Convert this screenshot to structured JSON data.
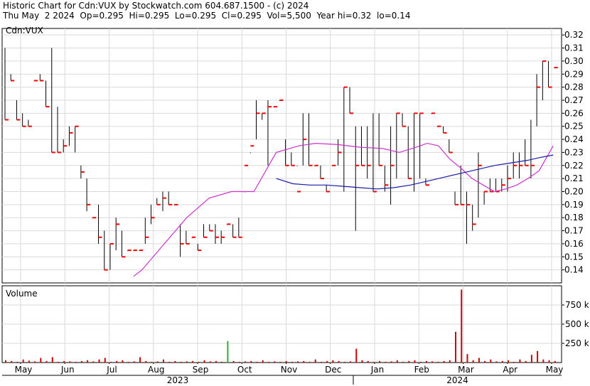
{
  "header": {
    "line1": "Historic Chart for Cdn:VUX by Stockwatch.com 604.687.1500 - (c) 2024",
    "line2": "Thu May  2 2024  Op=0.295  Hi=0.295  Lo=0.295  Cl=0.295  Vol=5,500  Year hi=0.32  lo=0.14"
  },
  "chart_data": {
    "type": "ohlc",
    "symbol_label": "Cdn:VUX",
    "volume_label": "Volume",
    "price_axis": {
      "min": 0.13,
      "max": 0.325,
      "ticks": [
        "0.32",
        "0.31",
        "0.30",
        "0.29",
        "0.28",
        "0.27",
        "0.26",
        "0.25",
        "0.24",
        "0.23",
        "0.22",
        "0.21",
        "0.20",
        "0.19",
        "0.18",
        "0.17",
        "0.16",
        "0.15",
        "0.14"
      ]
    },
    "volume_axis": {
      "min": 0,
      "max": 1000000,
      "ticks": [
        "750 k",
        "500 k",
        "250 k"
      ]
    },
    "months": [
      "May",
      "Jun",
      "Jul",
      "Aug",
      "Sep",
      "Oct",
      "Nov",
      "Dec",
      "Jan",
      "Feb",
      "Mar",
      "Apr",
      "May"
    ],
    "years": [
      "2023",
      "2024"
    ],
    "colors": {
      "bar": "#000000",
      "close_tick": "#ff0000",
      "ma_short": "#cc33cc",
      "ma_long": "#1a1aa8",
      "volume": "#cc0000",
      "volume_up": "#33aa33",
      "grid": "#d9d9d9"
    },
    "bars": [
      [
        0.31,
        0.255,
        0.255
      ],
      [
        0.29,
        0.285,
        0.285
      ],
      [
        0.27,
        0.255,
        0.255
      ],
      [
        0.26,
        0.25,
        0.25
      ],
      [
        0.255,
        0.25,
        0.25
      ],
      [
        0.285,
        0.285,
        0.285
      ],
      [
        0.29,
        0.285,
        0.285
      ],
      [
        0.285,
        0.265,
        0.265
      ],
      [
        0.31,
        0.23,
        0.23
      ],
      [
        0.265,
        0.23,
        0.23
      ],
      [
        0.24,
        0.23,
        0.235
      ],
      [
        0.25,
        0.235,
        0.245
      ],
      [
        0.25,
        0.23,
        0.25
      ],
      [
        0.22,
        0.21,
        0.215
      ],
      [
        0.21,
        0.185,
        0.19
      ],
      [
        0.18,
        0.18,
        0.18
      ],
      [
        0.19,
        0.16,
        0.165
      ],
      [
        0.17,
        0.14,
        0.14
      ],
      [
        0.16,
        0.14,
        0.16
      ],
      [
        0.18,
        0.155,
        0.175
      ],
      [
        0.17,
        0.15,
        0.15
      ],
      [
        0.155,
        0.155,
        0.155
      ],
      [
        0.155,
        0.155,
        0.155
      ],
      [
        0.155,
        0.155,
        0.155
      ],
      [
        0.18,
        0.16,
        0.165
      ],
      [
        0.19,
        0.175,
        0.18
      ],
      [
        0.195,
        0.19,
        0.19
      ],
      [
        0.2,
        0.185,
        0.195
      ],
      [
        0.2,
        0.19,
        0.19
      ],
      [
        0.19,
        0.19,
        0.19
      ],
      [
        0.175,
        0.15,
        0.16
      ],
      [
        0.17,
        0.16,
        0.16
      ],
      [
        0.165,
        0.165,
        0.165
      ],
      [
        0.16,
        0.155,
        0.155
      ],
      [
        0.175,
        0.165,
        0.165
      ],
      [
        0.175,
        0.17,
        0.17
      ],
      [
        0.175,
        0.16,
        0.165
      ],
      [
        0.17,
        0.16,
        0.165
      ],
      [
        0.175,
        0.175,
        0.175
      ],
      [
        0.175,
        0.165,
        0.165
      ],
      [
        0.18,
        0.165,
        0.165
      ],
      [
        0.2,
        0.22,
        0.22
      ],
      [
        0.23,
        0.235,
        0.235
      ],
      [
        0.27,
        0.24,
        0.26
      ],
      [
        0.26,
        0.255,
        0.26
      ],
      [
        0.27,
        0.22,
        0.265
      ],
      [
        0.265,
        0.265,
        0.265
      ],
      [
        0.27,
        0.27,
        0.27
      ],
      [
        0.24,
        0.22,
        0.22
      ],
      [
        0.23,
        0.22,
        0.22
      ],
      [
        0.22,
        0.22,
        0.2
      ],
      [
        0.26,
        0.22,
        0.24
      ],
      [
        0.26,
        0.22,
        0.22
      ],
      [
        0.22,
        0.22,
        0.22
      ],
      [
        0.22,
        0.21,
        0.21
      ],
      [
        0.205,
        0.2,
        0.2
      ],
      [
        0.22,
        0.22,
        0.22
      ],
      [
        0.24,
        0.22,
        0.23
      ],
      [
        0.28,
        0.2,
        0.28
      ],
      [
        0.28,
        0.26,
        0.26
      ],
      [
        0.25,
        0.17,
        0.22
      ],
      [
        0.25,
        0.22,
        0.22
      ],
      [
        0.25,
        0.21,
        0.22
      ],
      [
        0.26,
        0.2,
        0.2
      ],
      [
        0.26,
        0.22,
        0.22
      ],
      [
        0.22,
        0.2,
        0.205
      ],
      [
        0.25,
        0.19,
        0.22
      ],
      [
        0.26,
        0.21,
        0.26
      ],
      [
        0.26,
        0.25,
        0.25
      ],
      [
        0.25,
        0.21,
        0.21
      ],
      [
        0.26,
        0.2,
        0.26
      ],
      [
        0.26,
        0.21,
        0.26
      ],
      [
        0.21,
        0.205,
        0.205
      ],
      [
        0.26,
        0.26,
        0.26
      ],
      [
        0.25,
        0.25,
        0.25
      ],
      [
        0.25,
        0.245,
        0.245
      ],
      [
        0.24,
        0.23,
        0.23
      ],
      [
        0.2,
        0.19,
        0.19
      ],
      [
        0.22,
        0.19,
        0.19
      ],
      [
        0.2,
        0.16,
        0.19
      ],
      [
        0.19,
        0.17,
        0.175
      ],
      [
        0.23,
        0.18,
        0.22
      ],
      [
        0.2,
        0.19,
        0.2
      ],
      [
        0.21,
        0.2,
        0.2
      ],
      [
        0.21,
        0.2,
        0.2
      ],
      [
        0.21,
        0.2,
        0.205
      ],
      [
        0.22,
        0.2,
        0.21
      ],
      [
        0.23,
        0.21,
        0.22
      ],
      [
        0.23,
        0.21,
        0.22
      ],
      [
        0.24,
        0.22,
        0.22
      ],
      [
        0.255,
        0.21,
        0.22
      ],
      [
        0.29,
        0.25,
        0.28
      ],
      [
        0.3,
        0.27,
        0.3
      ],
      [
        0.3,
        0.28,
        0.28
      ],
      [
        0.295,
        0.295,
        0.295
      ]
    ],
    "ma_short": [
      [
        0.235,
        0.135
      ],
      [
        0.25,
        0.14
      ],
      [
        0.29,
        0.16
      ],
      [
        0.33,
        0.18
      ],
      [
        0.37,
        0.195
      ],
      [
        0.41,
        0.2
      ],
      [
        0.45,
        0.2
      ],
      [
        0.49,
        0.23
      ],
      [
        0.53,
        0.235
      ],
      [
        0.56,
        0.237
      ],
      [
        0.6,
        0.236
      ],
      [
        0.64,
        0.234
      ],
      [
        0.68,
        0.233
      ],
      [
        0.71,
        0.23
      ],
      [
        0.74,
        0.234
      ],
      [
        0.76,
        0.237
      ],
      [
        0.78,
        0.235
      ],
      [
        0.8,
        0.225
      ],
      [
        0.82,
        0.218
      ],
      [
        0.84,
        0.21
      ],
      [
        0.86,
        0.205
      ],
      [
        0.88,
        0.2
      ],
      [
        0.9,
        0.202
      ],
      [
        0.92,
        0.205
      ],
      [
        0.94,
        0.21
      ],
      [
        0.96,
        0.216
      ],
      [
        0.985,
        0.235
      ]
    ],
    "ma_long": [
      [
        0.49,
        0.21
      ],
      [
        0.52,
        0.206
      ],
      [
        0.55,
        0.205
      ],
      [
        0.58,
        0.205
      ],
      [
        0.61,
        0.204
      ],
      [
        0.64,
        0.203
      ],
      [
        0.67,
        0.202
      ],
      [
        0.7,
        0.203
      ],
      [
        0.73,
        0.205
      ],
      [
        0.76,
        0.208
      ],
      [
        0.79,
        0.211
      ],
      [
        0.82,
        0.214
      ],
      [
        0.85,
        0.217
      ],
      [
        0.88,
        0.22
      ],
      [
        0.91,
        0.222
      ],
      [
        0.94,
        0.224
      ],
      [
        0.96,
        0.226
      ],
      [
        0.985,
        0.228
      ]
    ],
    "volume": [
      30000,
      20000,
      10000,
      40000,
      25000,
      15000,
      60000,
      20000,
      70000,
      10000,
      20000,
      15000,
      10000,
      20000,
      30000,
      15000,
      40000,
      60000,
      10000,
      20000,
      30000,
      10000,
      15000,
      70000,
      20000,
      10000,
      15000,
      40000,
      10000,
      20000,
      10000,
      15000,
      20000,
      10000,
      30000,
      15000,
      20000,
      10000,
      280000,
      20000,
      10000,
      15000,
      20000,
      10000,
      30000,
      10000,
      15000,
      10000,
      20000,
      10000,
      15000,
      20000,
      10000,
      40000,
      10000,
      20000,
      30000,
      20000,
      10000,
      15000,
      180000,
      30000,
      20000,
      10000,
      20000,
      10000,
      15000,
      30000,
      10000,
      20000,
      30000,
      10000,
      20000,
      15000,
      10000,
      20000,
      30000,
      400000,
      950000,
      110000,
      30000,
      60000,
      20000,
      40000,
      15000,
      20000,
      30000,
      10000,
      40000,
      20000,
      100000,
      150000,
      40000,
      30000,
      20000
    ]
  }
}
